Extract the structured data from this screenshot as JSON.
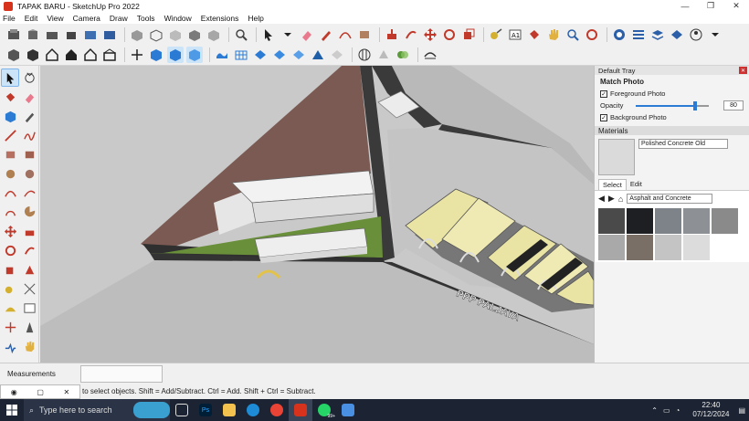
{
  "window": {
    "title": "TAPAK BARU - SketchUp Pro 2022",
    "minimize": "—",
    "maximize": "❐",
    "close": "✕"
  },
  "menu": [
    "File",
    "Edit",
    "View",
    "Camera",
    "Draw",
    "Tools",
    "Window",
    "Extensions",
    "Help"
  ],
  "tray": {
    "title": "Default Tray",
    "match_photo": {
      "title": "Match Photo",
      "foreground_label": "Foreground Photo",
      "foreground_checked": true,
      "opacity_label": "Opacity",
      "opacity_value": "80",
      "background_label": "Background Photo",
      "background_checked": true
    },
    "materials": {
      "title": "Materials",
      "current_name": "Polished Concrete Old",
      "tab_select": "Select",
      "tab_edit": "Edit",
      "library": "Asphalt and Concrete",
      "swatch_colors": [
        "#4a4a4a",
        "#1e1f22",
        "#7d8389",
        "#8d9196",
        "#8a8a8a",
        "#a9a9a9",
        "#7a6f66",
        "#c4c4c4",
        "#dcdcdc"
      ]
    }
  },
  "viewport": {
    "label_text": "PPP PALJAYA"
  },
  "status": {
    "measurements_label": "Measurements",
    "hint": "to select objects. Shift = Add/Subtract. Ctrl = Add. Shift + Ctrl = Subtract."
  },
  "taskbar": {
    "search_placeholder": "Type here to search",
    "time": "22:40",
    "date": "07/12/2024",
    "whatsapp_badge": "99+"
  },
  "colors": {
    "accent": "#2b7bd5",
    "taskbar": "#1c2433",
    "roof": "#e9e4a4",
    "grass": "#6a8f3a",
    "soil": "#7a5a52"
  }
}
